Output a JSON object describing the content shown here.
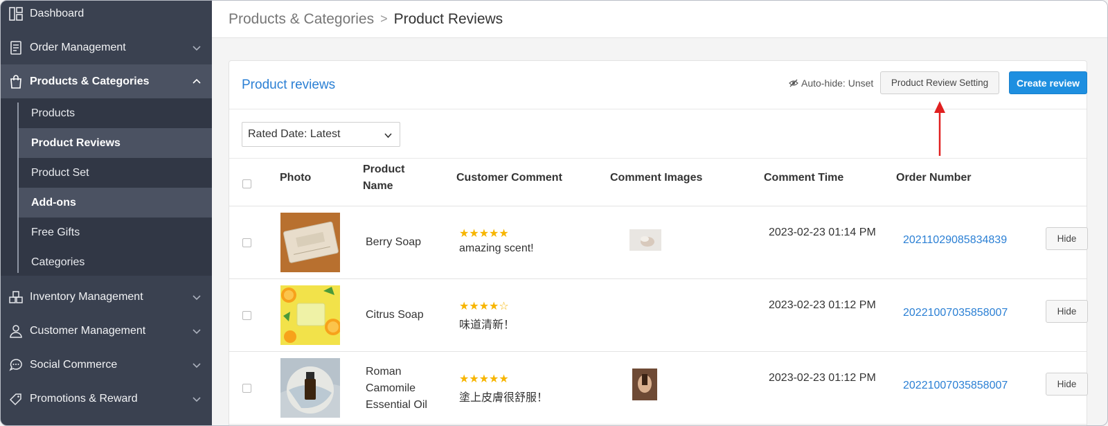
{
  "sidebar": {
    "items": [
      {
        "label": "Dashboard",
        "icon": "dashboard-icon"
      },
      {
        "label": "Order Management",
        "icon": "order-icon"
      },
      {
        "label": "Products & Categories",
        "icon": "bag-icon"
      },
      {
        "label": "Inventory Management",
        "icon": "inventory-icon"
      },
      {
        "label": "Customer Management",
        "icon": "user-icon"
      },
      {
        "label": "Social Commerce",
        "icon": "chat-icon"
      },
      {
        "label": "Promotions & Reward",
        "icon": "tag-icon"
      }
    ],
    "subitems": [
      {
        "label": "Products"
      },
      {
        "label": "Product Reviews"
      },
      {
        "label": "Product Set"
      },
      {
        "label": "Add-ons"
      },
      {
        "label": "Free Gifts"
      },
      {
        "label": "Categories"
      }
    ]
  },
  "breadcrumb": {
    "parent": "Products & Categories",
    "separator": ">",
    "current": "Product Reviews"
  },
  "card": {
    "title": "Product reviews",
    "auto_hide": "Auto-hide: Unset",
    "setting_button": "Product Review Setting",
    "create_button": "Create review",
    "sort_select": "Rated Date: Latest"
  },
  "table": {
    "headers": {
      "photo": "Photo",
      "product_name": "Product Name",
      "comment": "Customer Comment",
      "images": "Comment Images",
      "time": "Comment Time",
      "order": "Order Number"
    },
    "rows": [
      {
        "product": "Berry Soap",
        "stars": "★★★★★",
        "rating": 5,
        "comment": "amazing scent!",
        "time": "2023-02-23 01:14 PM",
        "order": "20211029085834839",
        "action": "Hide"
      },
      {
        "product": "Citrus Soap",
        "stars": "★★★★☆",
        "rating": 4,
        "comment": "味道清新！",
        "time": "2023-02-23 01:12 PM",
        "order": "20221007035858007",
        "action": "Hide"
      },
      {
        "product": "Roman Camomile Essential Oil",
        "stars": "★★★★★",
        "rating": 5,
        "comment": "塗上皮膚很舒服！",
        "time": "2023-02-23 01:12 PM",
        "order": "20221007035858007",
        "action": "Hide"
      }
    ]
  },
  "colors": {
    "sidebar": "#3a4150",
    "accent": "#1e8fe0",
    "link": "#2a7fd4",
    "star": "#f7b500",
    "annotation_arrow": "#e02020"
  }
}
